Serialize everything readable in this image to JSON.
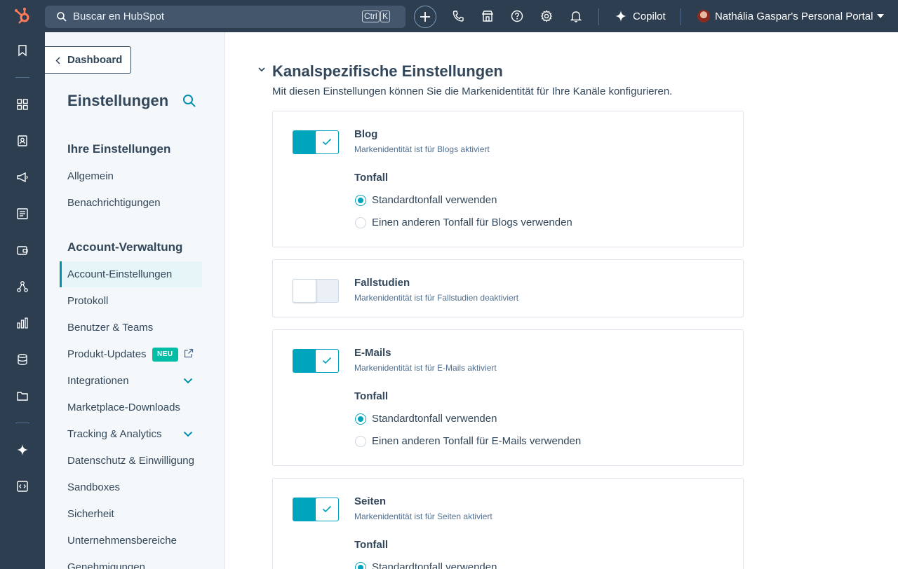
{
  "topbar": {
    "search_placeholder": "Buscar en HubSpot",
    "kbd_ctrl": "Ctrl",
    "kbd_k": "K",
    "copilot_label": "Copilot",
    "portal_name": "Nathália Gaspar's Personal Portal",
    "icons": [
      "plus-icon",
      "phone-icon",
      "marketplace-icon",
      "help-icon",
      "gear-icon",
      "bell-icon",
      "sparkle-icon"
    ]
  },
  "rail": {
    "icons": [
      "bookmark-icon",
      "apps-grid-icon",
      "contacts-icon",
      "megaphone-icon",
      "content-icon",
      "commerce-icon",
      "automation-icon",
      "reporting-icon",
      "database-icon",
      "folder-icon",
      "copilot-sparkle-icon",
      "code-icon"
    ]
  },
  "sidebar": {
    "back_label": "Dashboard",
    "title": "Einstellungen",
    "section_personal": "Ihre Einstellungen",
    "personal_items": [
      "Allgemein",
      "Benachrichtigungen"
    ],
    "section_account": "Account-Verwaltung",
    "account_items": [
      "Account-Einstellungen",
      "Protokoll",
      "Benutzer & Teams",
      "Produkt-Updates",
      "Integrationen",
      "Marketplace-Downloads",
      "Tracking & Analytics",
      "Datenschutz & Einwilligung",
      "Sandboxes",
      "Sicherheit",
      "Unternehmensbereiche",
      "Genehmigungen"
    ],
    "new_badge": "NEU"
  },
  "main": {
    "section_title": "Kanalspezifische Einstellungen",
    "section_desc": "Mit diesen Einstellungen können Sie die Markenidentität für Ihre Kanäle konfigurieren.",
    "tone_label": "Tonfall",
    "cards": [
      {
        "title": "Blog",
        "subtitle": "Markenidentität ist für Blogs aktiviert",
        "enabled": true,
        "option_default": "Standardtonfall verwenden",
        "option_other": "Einen anderen Tonfall für Blogs verwenden"
      },
      {
        "title": "Fallstudien",
        "subtitle": "Markenidentität ist für Fallstudien deaktiviert",
        "enabled": false
      },
      {
        "title": "E-Mails",
        "subtitle": "Markenidentität ist für E-Mails aktiviert",
        "enabled": true,
        "option_default": "Standardtonfall verwenden",
        "option_other": "Einen anderen Tonfall für E-Mails verwenden"
      },
      {
        "title": "Seiten",
        "subtitle": "Markenidentität ist für Seiten aktiviert",
        "enabled": true,
        "option_default": "Standardtonfall verwenden"
      }
    ]
  },
  "colors": {
    "topbar_bg": "#2d3e50",
    "accent": "#00a4bd",
    "text": "#33475b",
    "badge": "#00bda5"
  }
}
